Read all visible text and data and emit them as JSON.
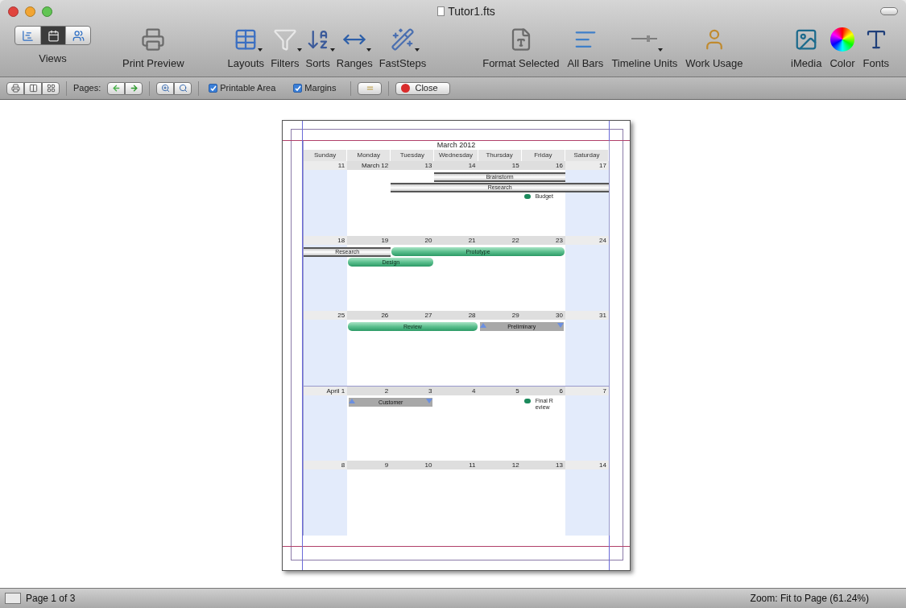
{
  "window": {
    "title": "Tutor1.fts"
  },
  "toolbar": {
    "views": [
      {
        "selected": false
      },
      {
        "selected": true
      },
      {
        "selected": false
      }
    ],
    "views_label": "Views",
    "items": [
      {
        "label": "Print Preview",
        "menu": false
      },
      {
        "label": "Layouts",
        "menu": true
      },
      {
        "label": "Filters",
        "menu": true
      },
      {
        "label": "Sorts",
        "menu": true
      },
      {
        "label": "Ranges",
        "menu": true
      },
      {
        "label": "FastSteps",
        "menu": true
      },
      {
        "label": "Format Selected",
        "menu": false
      },
      {
        "label": "All Bars",
        "menu": false
      },
      {
        "label": "Timeline Units",
        "menu": true
      },
      {
        "label": "Work Usage",
        "menu": false
      },
      {
        "label": "iMedia",
        "menu": false
      },
      {
        "label": "Color",
        "menu": false
      },
      {
        "label": "Fonts",
        "menu": false
      }
    ]
  },
  "print_bar": {
    "pages_label": "Pages:",
    "checkboxes": [
      {
        "label": "Printable Area",
        "checked": true
      },
      {
        "label": "Margins",
        "checked": true
      }
    ],
    "close": "Close"
  },
  "calendar": {
    "title": "March 2012",
    "weekdays": [
      "Sunday",
      "Monday",
      "Tuesday",
      "Wednesday",
      "Thursday",
      "Friday",
      "Saturday"
    ],
    "weeks": [
      {
        "dates": [
          "11",
          "March 12",
          "13",
          "14",
          "15",
          "16",
          "17"
        ],
        "items": [
          {
            "kind": "summary",
            "label": "Brainstorm"
          },
          {
            "kind": "summary",
            "label": "Research"
          },
          {
            "kind": "milestone",
            "label": "Budget"
          }
        ]
      },
      {
        "dates": [
          "18",
          "19",
          "20",
          "21",
          "22",
          "23",
          "24"
        ],
        "items": [
          {
            "kind": "summary",
            "label": "Research"
          },
          {
            "kind": "task",
            "label": "Prototype"
          },
          {
            "kind": "task",
            "label": "Design"
          }
        ]
      },
      {
        "dates": [
          "25",
          "26",
          "27",
          "28",
          "29",
          "30",
          "31"
        ],
        "items": [
          {
            "kind": "task",
            "label": "Review"
          },
          {
            "kind": "deliverable",
            "label": "Preliminary"
          }
        ]
      },
      {
        "dates": [
          "April 1",
          "2",
          "3",
          "4",
          "5",
          "6",
          "7"
        ],
        "items": [
          {
            "kind": "deliverable",
            "label": "Customer"
          },
          {
            "kind": "milestone",
            "label": "Final Review"
          }
        ]
      },
      {
        "dates": [
          "8",
          "9",
          "10",
          "11",
          "12",
          "13",
          "14"
        ]
      }
    ]
  },
  "status_bar": {
    "page": "Page 1 of 3",
    "zoom": "Zoom: Fit to Page (61.24%)"
  }
}
